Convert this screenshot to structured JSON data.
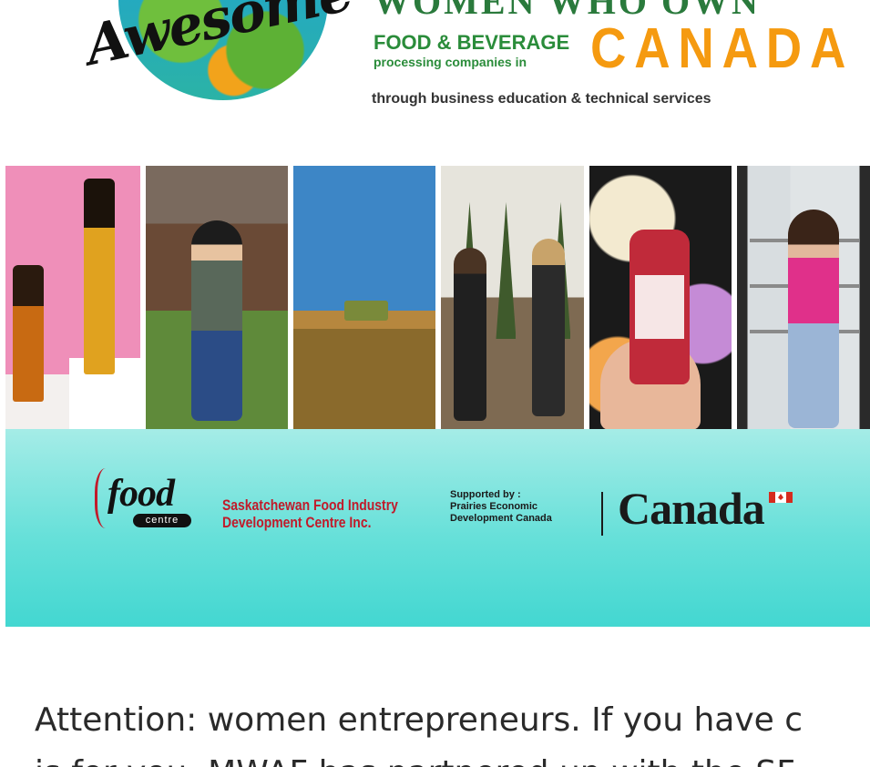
{
  "header": {
    "awesome_word": "Awesome",
    "women_who_own": "WOMEN WHO OWN",
    "food_beverage": "FOOD & BEVERAGE",
    "processing_companies": "processing companies in",
    "canada": "CANADA",
    "through": "through business education & technical services"
  },
  "banner": {
    "food_word": "food",
    "centre_label": "centre",
    "org_line1": "Saskatchewan Food Industry",
    "org_line2": "Development Centre Inc.",
    "supported_by": "Supported by :",
    "supporter_line1": "Prairies Economic",
    "supporter_line2": "Development Canada",
    "canada_wordmark": "Canada"
  },
  "article": {
    "line1": "Attention: women entrepreneurs. If you have c",
    "line2": "is for you. MWAF has partnered up with the SF"
  }
}
